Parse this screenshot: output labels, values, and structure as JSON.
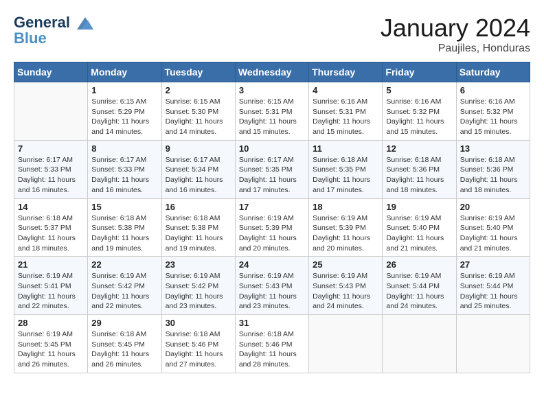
{
  "header": {
    "logo_line1": "General",
    "logo_line2": "Blue",
    "main_title": "January 2024",
    "subtitle": "Paujiles, Honduras"
  },
  "weekdays": [
    "Sunday",
    "Monday",
    "Tuesday",
    "Wednesday",
    "Thursday",
    "Friday",
    "Saturday"
  ],
  "weeks": [
    [
      {
        "day": "",
        "info": ""
      },
      {
        "day": "1",
        "info": "Sunrise: 6:15 AM\nSunset: 5:29 PM\nDaylight: 11 hours\nand 14 minutes."
      },
      {
        "day": "2",
        "info": "Sunrise: 6:15 AM\nSunset: 5:30 PM\nDaylight: 11 hours\nand 14 minutes."
      },
      {
        "day": "3",
        "info": "Sunrise: 6:15 AM\nSunset: 5:31 PM\nDaylight: 11 hours\nand 15 minutes."
      },
      {
        "day": "4",
        "info": "Sunrise: 6:16 AM\nSunset: 5:31 PM\nDaylight: 11 hours\nand 15 minutes."
      },
      {
        "day": "5",
        "info": "Sunrise: 6:16 AM\nSunset: 5:32 PM\nDaylight: 11 hours\nand 15 minutes."
      },
      {
        "day": "6",
        "info": "Sunrise: 6:16 AM\nSunset: 5:32 PM\nDaylight: 11 hours\nand 15 minutes."
      }
    ],
    [
      {
        "day": "7",
        "info": "Sunrise: 6:17 AM\nSunset: 5:33 PM\nDaylight: 11 hours\nand 16 minutes."
      },
      {
        "day": "8",
        "info": "Sunrise: 6:17 AM\nSunset: 5:33 PM\nDaylight: 11 hours\nand 16 minutes."
      },
      {
        "day": "9",
        "info": "Sunrise: 6:17 AM\nSunset: 5:34 PM\nDaylight: 11 hours\nand 16 minutes."
      },
      {
        "day": "10",
        "info": "Sunrise: 6:17 AM\nSunset: 5:35 PM\nDaylight: 11 hours\nand 17 minutes."
      },
      {
        "day": "11",
        "info": "Sunrise: 6:18 AM\nSunset: 5:35 PM\nDaylight: 11 hours\nand 17 minutes."
      },
      {
        "day": "12",
        "info": "Sunrise: 6:18 AM\nSunset: 5:36 PM\nDaylight: 11 hours\nand 18 minutes."
      },
      {
        "day": "13",
        "info": "Sunrise: 6:18 AM\nSunset: 5:36 PM\nDaylight: 11 hours\nand 18 minutes."
      }
    ],
    [
      {
        "day": "14",
        "info": "Sunrise: 6:18 AM\nSunset: 5:37 PM\nDaylight: 11 hours\nand 18 minutes."
      },
      {
        "day": "15",
        "info": "Sunrise: 6:18 AM\nSunset: 5:38 PM\nDaylight: 11 hours\nand 19 minutes."
      },
      {
        "day": "16",
        "info": "Sunrise: 6:18 AM\nSunset: 5:38 PM\nDaylight: 11 hours\nand 19 minutes."
      },
      {
        "day": "17",
        "info": "Sunrise: 6:19 AM\nSunset: 5:39 PM\nDaylight: 11 hours\nand 20 minutes."
      },
      {
        "day": "18",
        "info": "Sunrise: 6:19 AM\nSunset: 5:39 PM\nDaylight: 11 hours\nand 20 minutes."
      },
      {
        "day": "19",
        "info": "Sunrise: 6:19 AM\nSunset: 5:40 PM\nDaylight: 11 hours\nand 21 minutes."
      },
      {
        "day": "20",
        "info": "Sunrise: 6:19 AM\nSunset: 5:40 PM\nDaylight: 11 hours\nand 21 minutes."
      }
    ],
    [
      {
        "day": "21",
        "info": "Sunrise: 6:19 AM\nSunset: 5:41 PM\nDaylight: 11 hours\nand 22 minutes."
      },
      {
        "day": "22",
        "info": "Sunrise: 6:19 AM\nSunset: 5:42 PM\nDaylight: 11 hours\nand 22 minutes."
      },
      {
        "day": "23",
        "info": "Sunrise: 6:19 AM\nSunset: 5:42 PM\nDaylight: 11 hours\nand 23 minutes."
      },
      {
        "day": "24",
        "info": "Sunrise: 6:19 AM\nSunset: 5:43 PM\nDaylight: 11 hours\nand 23 minutes."
      },
      {
        "day": "25",
        "info": "Sunrise: 6:19 AM\nSunset: 5:43 PM\nDaylight: 11 hours\nand 24 minutes."
      },
      {
        "day": "26",
        "info": "Sunrise: 6:19 AM\nSunset: 5:44 PM\nDaylight: 11 hours\nand 24 minutes."
      },
      {
        "day": "27",
        "info": "Sunrise: 6:19 AM\nSunset: 5:44 PM\nDaylight: 11 hours\nand 25 minutes."
      }
    ],
    [
      {
        "day": "28",
        "info": "Sunrise: 6:19 AM\nSunset: 5:45 PM\nDaylight: 11 hours\nand 26 minutes."
      },
      {
        "day": "29",
        "info": "Sunrise: 6:18 AM\nSunset: 5:45 PM\nDaylight: 11 hours\nand 26 minutes."
      },
      {
        "day": "30",
        "info": "Sunrise: 6:18 AM\nSunset: 5:46 PM\nDaylight: 11 hours\nand 27 minutes."
      },
      {
        "day": "31",
        "info": "Sunrise: 6:18 AM\nSunset: 5:46 PM\nDaylight: 11 hours\nand 28 minutes."
      },
      {
        "day": "",
        "info": ""
      },
      {
        "day": "",
        "info": ""
      },
      {
        "day": "",
        "info": ""
      }
    ]
  ]
}
